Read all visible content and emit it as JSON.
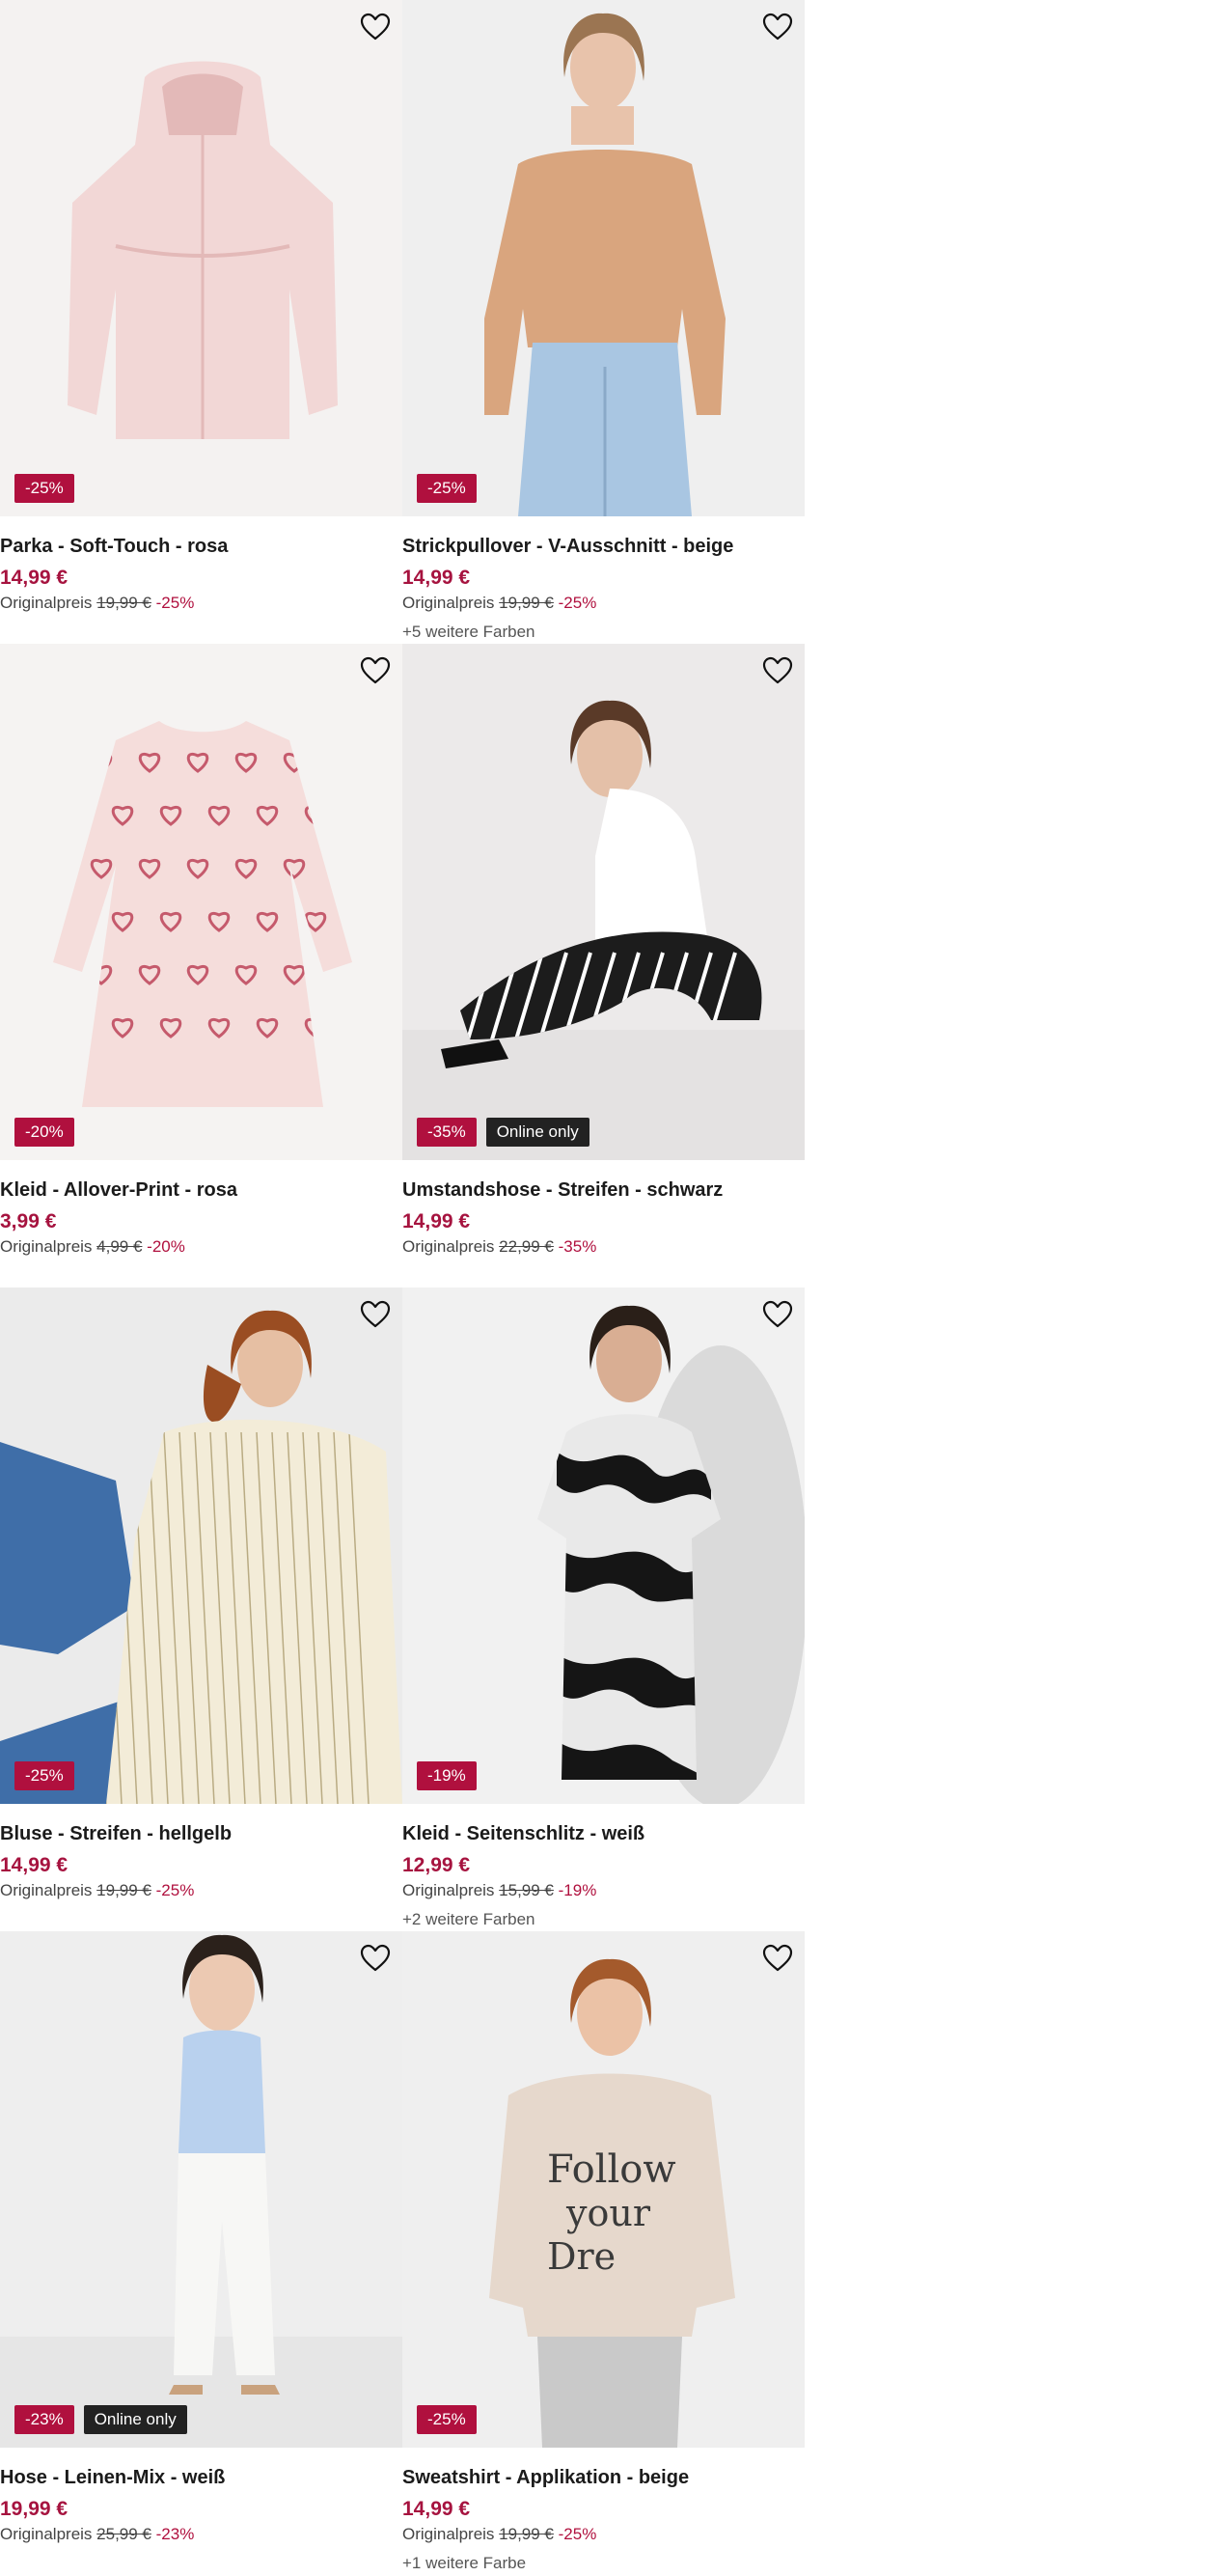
{
  "products": [
    {
      "title": "Parka - Soft-Touch - rosa",
      "price": "14,99 €",
      "orig_label": "Originalpreis",
      "orig_price": "19,99 €",
      "orig_pct": "-25%",
      "badges": [
        "-25%"
      ],
      "colors": "",
      "art": {
        "bg": "#f4f2f1",
        "item": "#f2d7d6",
        "accent": "#e3b9b8",
        "type": "parka"
      }
    },
    {
      "title": "Strickpullover - V-Ausschnitt - beige",
      "price": "14,99 €",
      "orig_label": "Originalpreis",
      "orig_price": "19,99 €",
      "orig_pct": "-25%",
      "badges": [
        "-25%"
      ],
      "colors": "+5 weitere Farben",
      "art": {
        "bg": "#efefef",
        "item": "#d9a57e",
        "accent": "#a9c6e2",
        "skin": "#e8c3ab",
        "hair": "#9b7552",
        "type": "sweater"
      }
    },
    {
      "title": "Kleid - Allover-Print - rosa",
      "price": "3,99 €",
      "orig_label": "Originalpreis",
      "orig_price": "4,99 €",
      "orig_pct": "-20%",
      "badges": [
        "-20%"
      ],
      "colors": "",
      "art": {
        "bg": "#f5f3f2",
        "item": "#f5dddb",
        "accent": "#c55a6c",
        "type": "kids-dress"
      }
    },
    {
      "title": "Umstandshose - Streifen - schwarz",
      "price": "14,99 €",
      "orig_label": "Originalpreis",
      "orig_price": "22,99 €",
      "orig_pct": "-35%",
      "badges": [
        "-35%",
        "Online only"
      ],
      "colors": "",
      "art": {
        "bg": "#eceaea",
        "item": "#1c1c1c",
        "accent": "#ffffff",
        "skin": "#e4c0a8",
        "hair": "#5a3a28",
        "type": "pants-sitting"
      }
    },
    {
      "title": "Bluse - Streifen - hellgelb",
      "price": "14,99 €",
      "orig_label": "Originalpreis",
      "orig_price": "19,99 €",
      "orig_pct": "-25%",
      "badges": [
        "-25%"
      ],
      "colors": "",
      "art": {
        "bg": "#ebebeb",
        "item": "#f3ecd8",
        "accent": "#b9ab83",
        "skin": "#e6bfa3",
        "hair": "#9a4d22",
        "jeans": "#3f6ea8",
        "type": "blouse"
      }
    },
    {
      "title": "Kleid - Seitenschlitz - weiß",
      "price": "12,99 €",
      "orig_label": "Originalpreis",
      "orig_price": "15,99 €",
      "orig_pct": "-19%",
      "badges": [
        "-19%"
      ],
      "colors": "+2 weitere Farben",
      "art": {
        "bg": "#f1f1f1",
        "item": "#e9e9e9",
        "accent": "#151515",
        "skin": "#d9ae93",
        "hair": "#2a1f18",
        "type": "zebra-dress"
      }
    },
    {
      "title": "Hose - Leinen-Mix - weiß",
      "price": "19,99 €",
      "orig_label": "Originalpreis",
      "orig_price": "25,99 €",
      "orig_pct": "-23%",
      "badges": [
        "-23%",
        "Online only"
      ],
      "colors": "",
      "art": {
        "bg": "#eeeeee",
        "item": "#f7f7f5",
        "accent": "#b9d1ee",
        "skin": "#ecc9b2",
        "hair": "#2b211b",
        "type": "linen-pants"
      }
    },
    {
      "title": "Sweatshirt - Applikation - beige",
      "price": "14,99 €",
      "orig_label": "Originalpreis",
      "orig_price": "19,99 €",
      "orig_pct": "-25%",
      "badges": [
        "-25%"
      ],
      "colors": "+1 weitere Farbe",
      "art": {
        "bg": "#efefef",
        "item": "#e6d8cc",
        "accent": "#3a3a3a",
        "skin": "#ebc2a6",
        "hair": "#a45a2c",
        "jeans": "#c9c9c9",
        "type": "sweatshirt"
      }
    }
  ]
}
